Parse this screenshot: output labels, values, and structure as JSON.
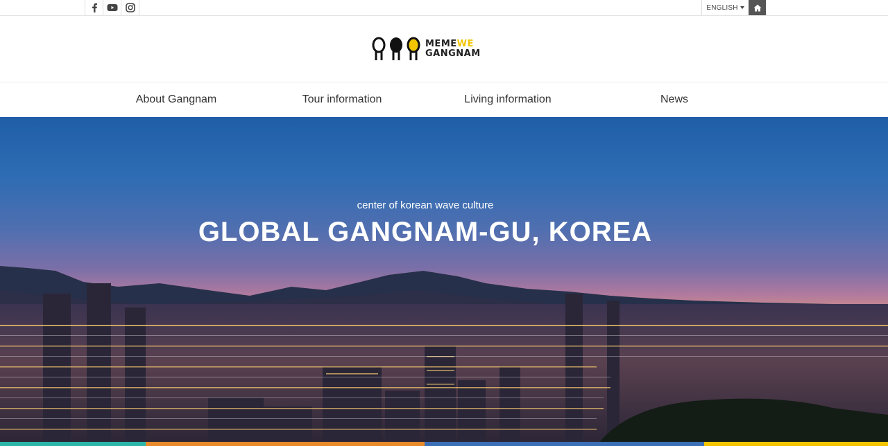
{
  "topbar": {
    "social": [
      {
        "icon": "facebook-icon",
        "glyph": "f"
      },
      {
        "icon": "youtube-icon",
        "glyph": "▶"
      },
      {
        "icon": "instagram-icon",
        "glyph": "◎"
      }
    ],
    "language": "ENGLISH",
    "home_icon": "home-icon"
  },
  "logo": {
    "line1_a": "MEME",
    "line1_b": "WE",
    "line2": "GANGNAM",
    "colors": {
      "dark": "#111111",
      "yellow": "#f2c500"
    }
  },
  "nav": {
    "items": [
      {
        "label": "About Gangnam"
      },
      {
        "label": "Tour information"
      },
      {
        "label": "Living information"
      },
      {
        "label": "News"
      }
    ]
  },
  "hero": {
    "subtitle": "center of korean wave culture",
    "title": "GLOBAL GANGNAM-GU, KOREA"
  },
  "accent_stripes": [
    "#2bb5a8",
    "#e88a2a",
    "#3b6fb6",
    "#f2c500"
  ]
}
